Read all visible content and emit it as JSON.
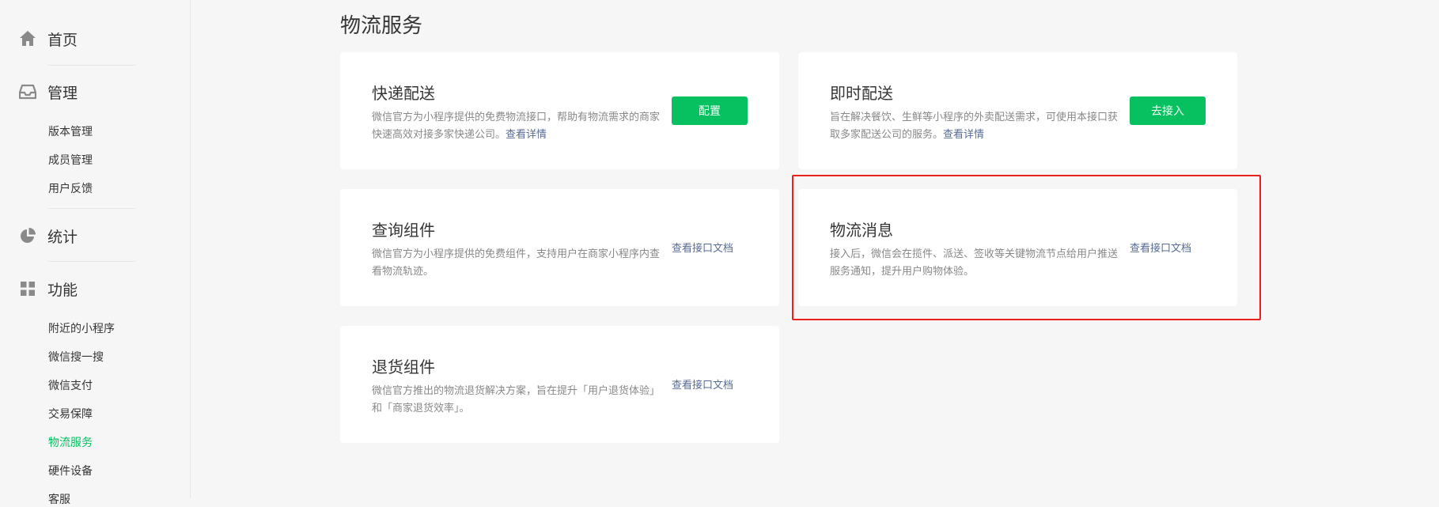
{
  "sidebar": {
    "home_label": "首页",
    "manage": {
      "label": "管理",
      "items": [
        "版本管理",
        "成员管理",
        "用户反馈"
      ]
    },
    "stats_label": "统计",
    "features": {
      "label": "功能",
      "items": [
        "附近的小程序",
        "微信搜一搜",
        "微信支付",
        "交易保障",
        "物流服务",
        "硬件设备",
        "客服"
      ],
      "active": "物流服务"
    }
  },
  "main": {
    "title": "物流服务",
    "cards": [
      {
        "title": "快递配送",
        "description": "微信官方为小程序提供的免费物流接口，帮助有物流需求的商家快速高效对接多家快递公司。",
        "detail_link": "查看详情",
        "button_label": "配置"
      },
      {
        "title": "即时配送",
        "description": "旨在解决餐饮、生鲜等小程序的外卖配送需求，可使用本接口获取多家配送公司的服务。",
        "detail_link": "查看详情",
        "button_label": "去接入"
      },
      {
        "title": "查询组件",
        "description": "微信官方为小程序提供的免费组件，支持用户在商家小程序内查看物流轨迹。",
        "doc_link": "查看接口文档"
      },
      {
        "title": "物流消息",
        "description": "接入后，微信会在揽件、派送、签收等关键物流节点给用户推送服务通知，提升用户购物体验。",
        "doc_link": "查看接口文档"
      },
      {
        "title": "退货组件",
        "description": "微信官方推出的物流退货解决方案，旨在提升「用户退货体验」和「商家退货效率」。",
        "doc_link": "查看接口文档"
      }
    ]
  },
  "colors": {
    "accent_green": "#07c160",
    "link_blue": "#576b95",
    "highlight_red": "#e8211f",
    "page_bg": "#f6f6f6"
  },
  "icons": {
    "home": "home-icon",
    "manage": "inbox-icon",
    "stats": "pie-chart-icon",
    "features": "grid-icon"
  }
}
